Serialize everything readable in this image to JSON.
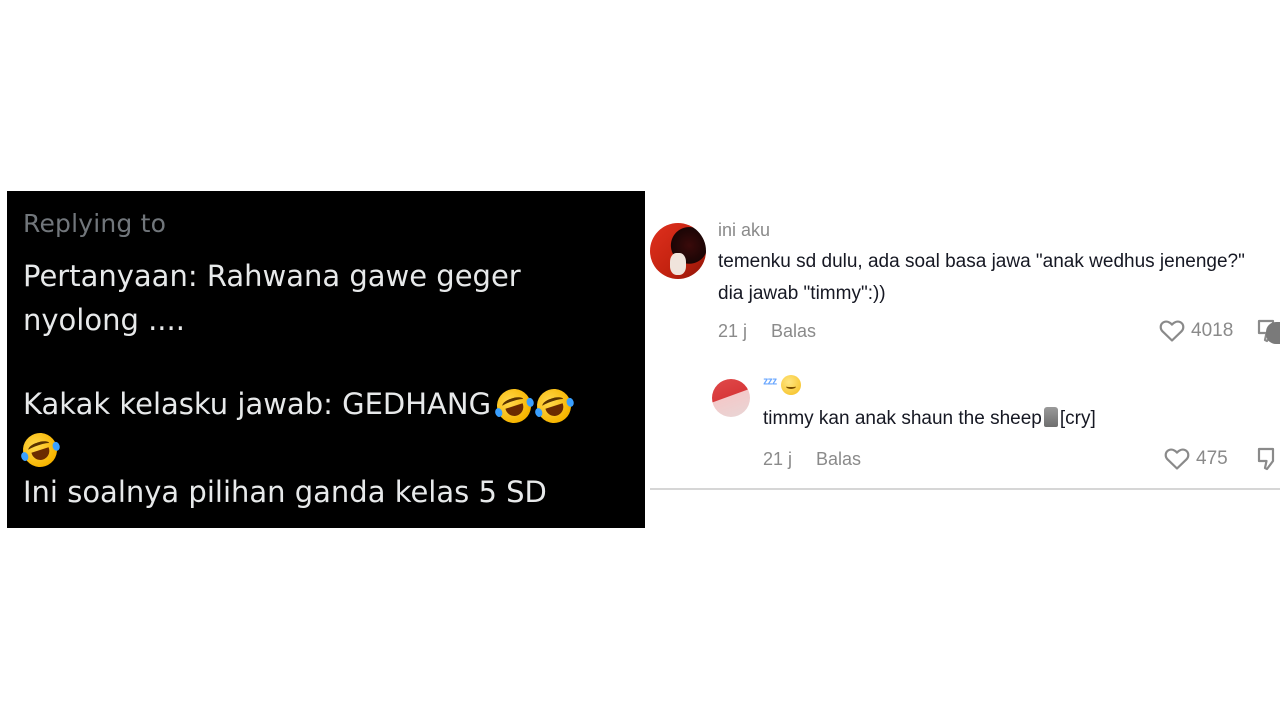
{
  "tweet": {
    "replying_to": "Replying to",
    "line1": "Pertanyaan: Rahwana gawe geger",
    "line2": "nyolong ....",
    "line3": "Kakak kelasku jawab: GEDHANG",
    "line5": "Ini soalnya pilihan ganda kelas 5 SD",
    "emoji_name": "rolling-on-the-floor-laughing"
  },
  "comments": [
    {
      "username": "ini aku",
      "text_line1": "temenku sd dulu, ada soal basa jawa \"anak wedhus jenenge?\"",
      "text_line2": "dia jawab \"timmy\":))",
      "time": "21 j",
      "reply_label": "Balas",
      "likes": "4018"
    },
    {
      "username_emoji": "zzz sleeping-face",
      "zzz": "ᶻᶻᶻ",
      "text_before": "timmy kan anak shaun the sheep",
      "text_after": "[cry]",
      "time": "21 j",
      "reply_label": "Balas",
      "likes": "475"
    }
  ],
  "colors": {
    "tweet_bg": "#000000",
    "tweet_text": "#e7e9ea",
    "tweet_muted": "#71767b",
    "comment_text": "#161823",
    "comment_muted": "#8a8a8a"
  }
}
